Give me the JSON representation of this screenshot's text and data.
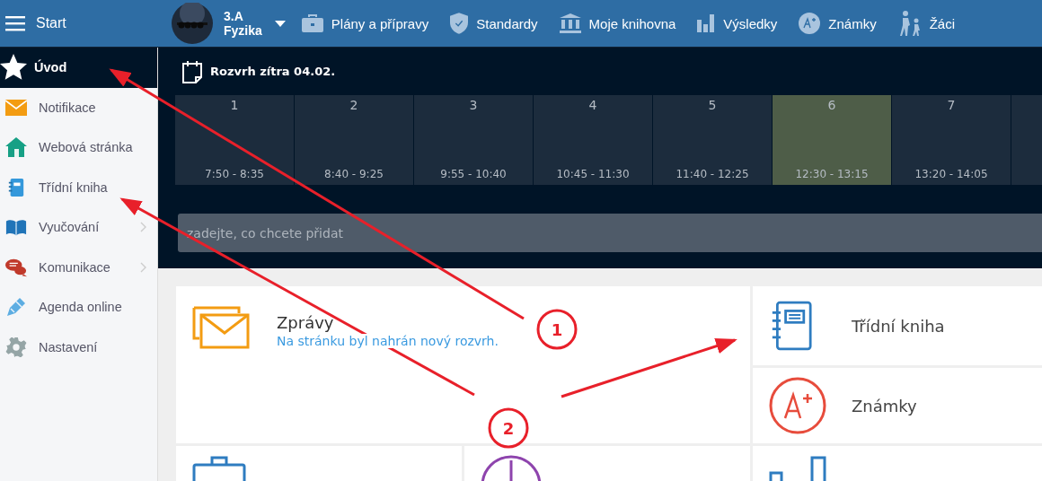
{
  "topbar": {
    "menu_label": "Start",
    "class_name": "3.A",
    "subject": "Fyzika",
    "nav": [
      {
        "label": "Plány a přípravy"
      },
      {
        "label": "Standardy"
      },
      {
        "label": "Moje knihovna"
      },
      {
        "label": "Výsledky"
      },
      {
        "label": "Známky"
      },
      {
        "label": "Žáci"
      }
    ]
  },
  "sidebar": {
    "items": [
      {
        "label": "Úvod",
        "selected": true,
        "has_submenu": false
      },
      {
        "label": "Notifikace",
        "selected": false,
        "has_submenu": false
      },
      {
        "label": "Webová stránka",
        "selected": false,
        "has_submenu": false
      },
      {
        "label": "Třídní kniha",
        "selected": false,
        "has_submenu": false
      },
      {
        "label": "Vyučování",
        "selected": false,
        "has_submenu": true
      },
      {
        "label": "Komunikace",
        "selected": false,
        "has_submenu": true
      },
      {
        "label": "Agenda online",
        "selected": false,
        "has_submenu": false
      },
      {
        "label": "Nastavení",
        "selected": false,
        "has_submenu": false
      }
    ]
  },
  "schedule": {
    "title": "Rozvrh zítra 04.02.",
    "lessons": [
      {
        "number": "1",
        "time": "7:50 - 8:35",
        "selected": false
      },
      {
        "number": "2",
        "time": "8:40 - 9:25",
        "selected": false
      },
      {
        "number": "3",
        "time": "9:55 - 10:40",
        "selected": false
      },
      {
        "number": "4",
        "time": "10:45 - 11:30",
        "selected": false
      },
      {
        "number": "5",
        "time": "11:40 - 12:25",
        "selected": false
      },
      {
        "number": "6",
        "time": "12:30 - 13:15",
        "selected": true
      },
      {
        "number": "7",
        "time": "13:20 - 14:05",
        "selected": false
      }
    ]
  },
  "add_field": {
    "placeholder": "zadejte, co chcete přidat"
  },
  "tiles": {
    "messages": {
      "title": "Zprávy",
      "message": "Na stránku byl nahrán nový rozvrh."
    },
    "class_book": {
      "title": "Třídní kniha"
    },
    "grades": {
      "title": "Známky"
    }
  },
  "annotations": [
    {
      "number": "1"
    },
    {
      "number": "2"
    }
  ]
}
